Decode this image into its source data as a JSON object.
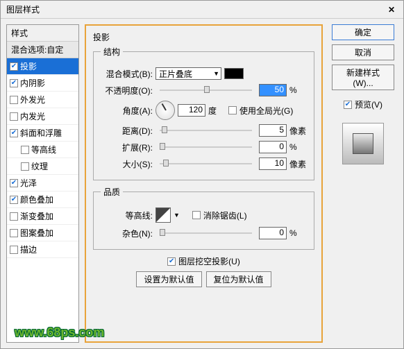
{
  "window": {
    "title": "图层样式",
    "close": "✕"
  },
  "left": {
    "header": "样式",
    "blendHeader": "混合选项:自定",
    "items": [
      {
        "label": "投影",
        "checked": true,
        "selected": true
      },
      {
        "label": "内阴影",
        "checked": true
      },
      {
        "label": "外发光",
        "checked": false
      },
      {
        "label": "内发光",
        "checked": false
      },
      {
        "label": "斜面和浮雕",
        "checked": true
      },
      {
        "label": "等高线",
        "checked": false,
        "indent": true
      },
      {
        "label": "纹理",
        "checked": false,
        "indent": true
      },
      {
        "label": "光泽",
        "checked": true
      },
      {
        "label": "颜色叠加",
        "checked": true
      },
      {
        "label": "渐变叠加",
        "checked": false
      },
      {
        "label": "图案叠加",
        "checked": false
      },
      {
        "label": "描边",
        "checked": false
      }
    ]
  },
  "center": {
    "title": "投影",
    "struct": {
      "legend": "结构",
      "blendMode": {
        "label": "混合模式(B):",
        "value": "正片叠底"
      },
      "opacity": {
        "label": "不透明度(O):",
        "value": "50",
        "unit": "%"
      },
      "angle": {
        "label": "角度(A):",
        "value": "120",
        "unit": "度",
        "global": {
          "label": "使用全局光(G)",
          "checked": false
        }
      },
      "distance": {
        "label": "距离(D):",
        "value": "5",
        "unit": "像素"
      },
      "spread": {
        "label": "扩展(R):",
        "value": "0",
        "unit": "%"
      },
      "size": {
        "label": "大小(S):",
        "value": "10",
        "unit": "像素"
      }
    },
    "quality": {
      "legend": "品质",
      "contour": {
        "label": "等高线:",
        "antialias": {
          "label": "消除锯齿(L)",
          "checked": false
        }
      },
      "noise": {
        "label": "杂色(N):",
        "value": "0",
        "unit": "%"
      }
    },
    "knockout": {
      "label": "图层挖空投影(U)",
      "checked": true
    },
    "setDefault": "设置为默认值",
    "resetDefault": "复位为默认值"
  },
  "right": {
    "ok": "确定",
    "cancel": "取消",
    "newStyle": "新建样式(W)...",
    "preview": {
      "label": "预览(V)",
      "checked": true
    }
  },
  "watermark": "www.68ps.com"
}
